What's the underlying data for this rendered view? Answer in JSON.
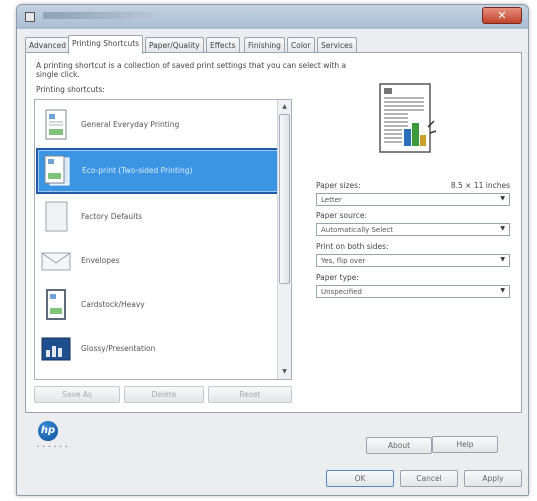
{
  "window": {
    "close_glyph": "✕"
  },
  "tabs": [
    {
      "label": "Advanced"
    },
    {
      "label": "Printing Shortcuts"
    },
    {
      "label": "Paper/Quality"
    },
    {
      "label": "Effects"
    },
    {
      "label": "Finishing"
    },
    {
      "label": "Color"
    },
    {
      "label": "Services"
    }
  ],
  "panel": {
    "description": "A printing shortcut is a collection of saved print settings that you can select with a single click.",
    "shortcuts_label": "Printing shortcuts:"
  },
  "shortcuts": [
    {
      "label": "General Everyday Printing",
      "icon": "document-icon",
      "selected": false
    },
    {
      "label": "Eco-print (Two-sided Printing)",
      "icon": "duplex-document-icon",
      "selected": true
    },
    {
      "label": "Factory Defaults",
      "icon": "blank-page-icon",
      "selected": false
    },
    {
      "label": "Envelopes",
      "icon": "envelope-icon",
      "selected": false
    },
    {
      "label": "Cardstock/Heavy",
      "icon": "cardstock-icon",
      "selected": false
    },
    {
      "label": "Glossy/Presentation",
      "icon": "presentation-icon",
      "selected": false
    }
  ],
  "list_buttons": {
    "save_as": "Save As",
    "delete": "Delete",
    "reset": "Reset"
  },
  "settings": {
    "paper_size_label": "Paper sizes:",
    "paper_size_value": "8.5 × 11 inches",
    "paper_size_selected": "Letter",
    "paper_source_label": "Paper source:",
    "paper_source_selected": "Automatically Select",
    "print_both_sides_label": "Print on both sides:",
    "print_both_sides_selected": "Yes, flip over",
    "paper_type_label": "Paper type:",
    "paper_type_selected": "Unspecified"
  },
  "footer": {
    "about": "About",
    "help": "Help",
    "ok": "OK",
    "cancel": "Cancel",
    "apply": "Apply",
    "brand": "hp",
    "brand_dots": "• • • • • •"
  },
  "colors": {
    "selection": "#3c95e3",
    "selection_border": "#1e5aa8",
    "close_button": "#c2432b"
  }
}
